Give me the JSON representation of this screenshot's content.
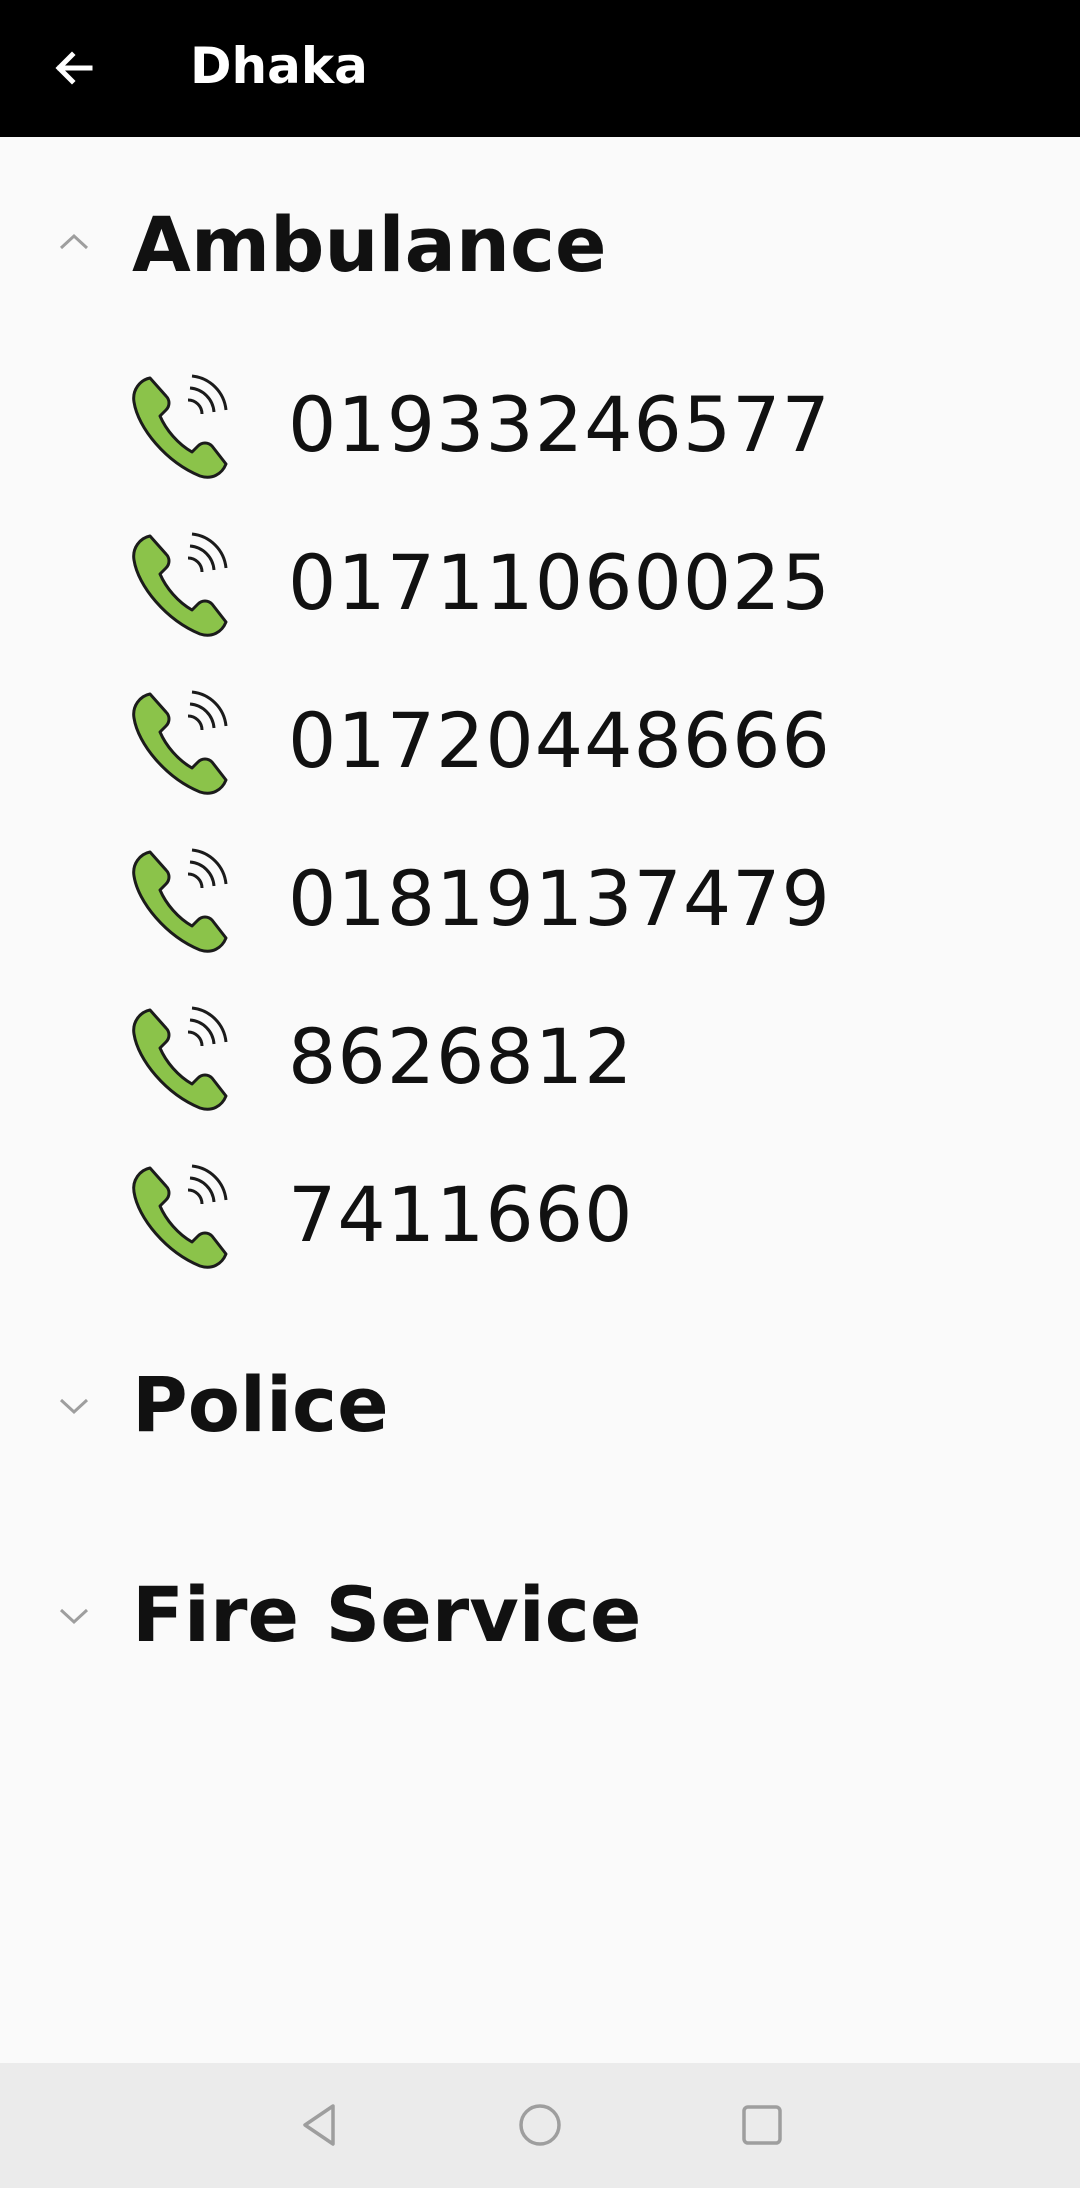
{
  "toolbar": {
    "back_icon": "arrow-left-icon",
    "title": "Dhaka",
    "background": "#000000"
  },
  "groups": [
    {
      "label": "Ambulance",
      "expanded": true,
      "chevron_icon": "chevron-up-icon",
      "numbers": [
        "01933246577",
        "01711060025",
        "01720448666",
        "01819137479",
        "8626812",
        "7411660"
      ]
    },
    {
      "label": "Police",
      "expanded": false,
      "chevron_icon": "chevron-down-icon",
      "numbers": []
    },
    {
      "label": "Fire Service",
      "expanded": false,
      "chevron_icon": "chevron-down-icon",
      "numbers": []
    }
  ],
  "phone_icon": "phone-call-icon",
  "phone_icon_color": "#8bc34a",
  "navbar": {
    "back_icon": "triangle-back-icon",
    "home_icon": "circle-home-icon",
    "recents_icon": "square-recents-icon"
  }
}
